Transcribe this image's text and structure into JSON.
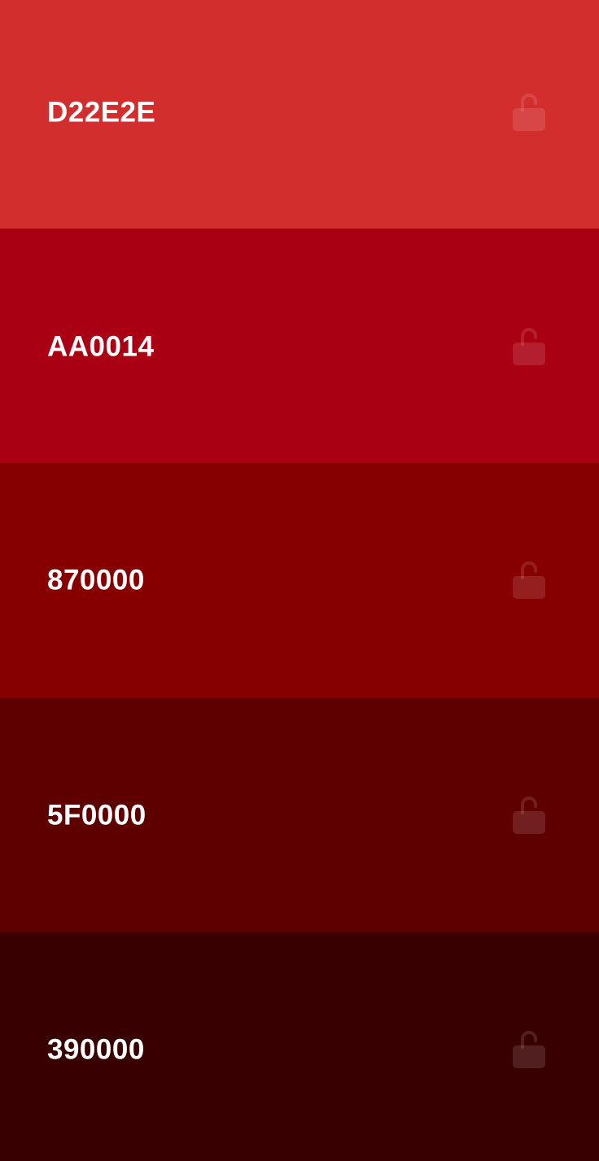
{
  "palette": {
    "swatches": [
      {
        "hex": "D22E2E",
        "color": "#D22E2E",
        "locked": false,
        "icon": "unlock-icon"
      },
      {
        "hex": "AA0014",
        "color": "#AA0014",
        "locked": false,
        "icon": "unlock-icon"
      },
      {
        "hex": "870000",
        "color": "#870000",
        "locked": false,
        "icon": "unlock-icon"
      },
      {
        "hex": "5F0000",
        "color": "#5F0000",
        "locked": false,
        "icon": "unlock-icon"
      },
      {
        "hex": "390000",
        "color": "#390000",
        "locked": false,
        "icon": "unlock-icon"
      }
    ]
  }
}
